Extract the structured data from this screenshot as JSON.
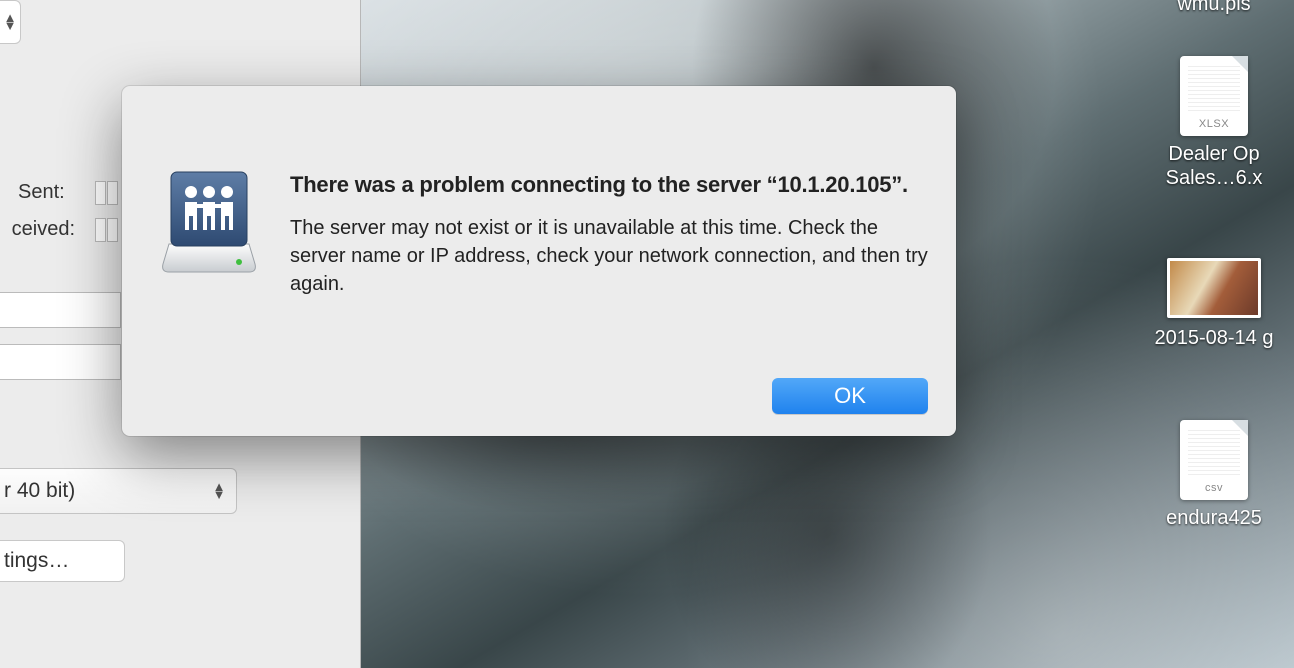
{
  "dialog": {
    "title": "There was a problem connecting to the server “10.1.20.105”.",
    "message": "The server may not exist or it is unavailable at this time. Check the server name or IP address, check your network connection, and then try again.",
    "ok_label": "OK"
  },
  "left_panel": {
    "sent_label": "Sent:",
    "received_label": "ceived:",
    "dropdown_text": "r 40 bit)",
    "settings_text": "tings…"
  },
  "desktop": {
    "items": [
      {
        "type": "label_only",
        "label": "wmu.pis"
      },
      {
        "type": "file",
        "tag": "XLSX",
        "label": "Dealer Op Sales…6.x"
      },
      {
        "type": "image",
        "label": "2015-08-14 g"
      },
      {
        "type": "file",
        "tag": "csv",
        "label": "endura425"
      }
    ]
  }
}
